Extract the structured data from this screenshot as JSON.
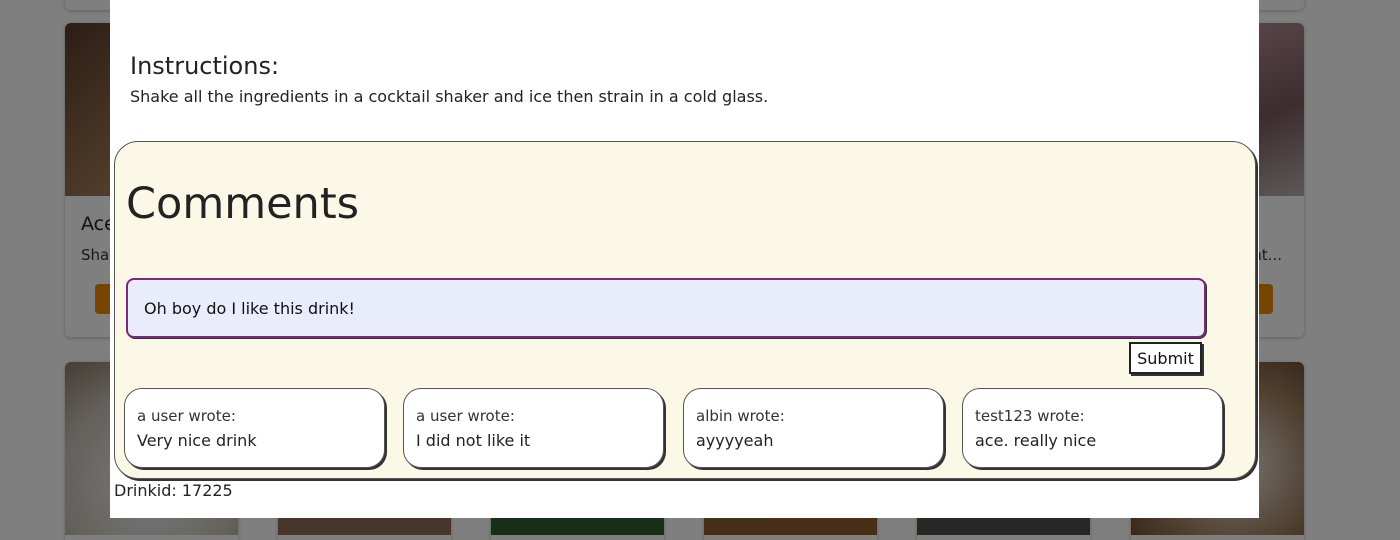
{
  "background": {
    "cards_row1": [
      {
        "title": "Ace",
        "desc": "Sha",
        "img_color": "#6e4a33"
      },
      {
        "title": "",
        "desc": "nt...",
        "img_color": "#8b6b6b"
      }
    ]
  },
  "modal": {
    "instructions": {
      "heading": "Instructions:",
      "text": "Shake all the ingredients in a cocktail shaker and ice then strain in a cold glass."
    },
    "comments": {
      "heading": "Comments",
      "input_value": "Oh boy do I like this drink!",
      "submit_label": "Submit",
      "items": [
        {
          "author": "a user wrote:",
          "text": "Very nice drink"
        },
        {
          "author": "a user wrote:",
          "text": "I did not like it"
        },
        {
          "author": "albin wrote:",
          "text": "ayyyyeah"
        },
        {
          "author": "test123 wrote:",
          "text": "ace. really nice"
        }
      ]
    },
    "drinkid_label": "Drinkid: 17225"
  },
  "colors": {
    "comments_bg": "#fcf8e8",
    "input_bg": "#e8ecfb",
    "input_border": "#7a2a78",
    "card_button": "#f08a00"
  }
}
